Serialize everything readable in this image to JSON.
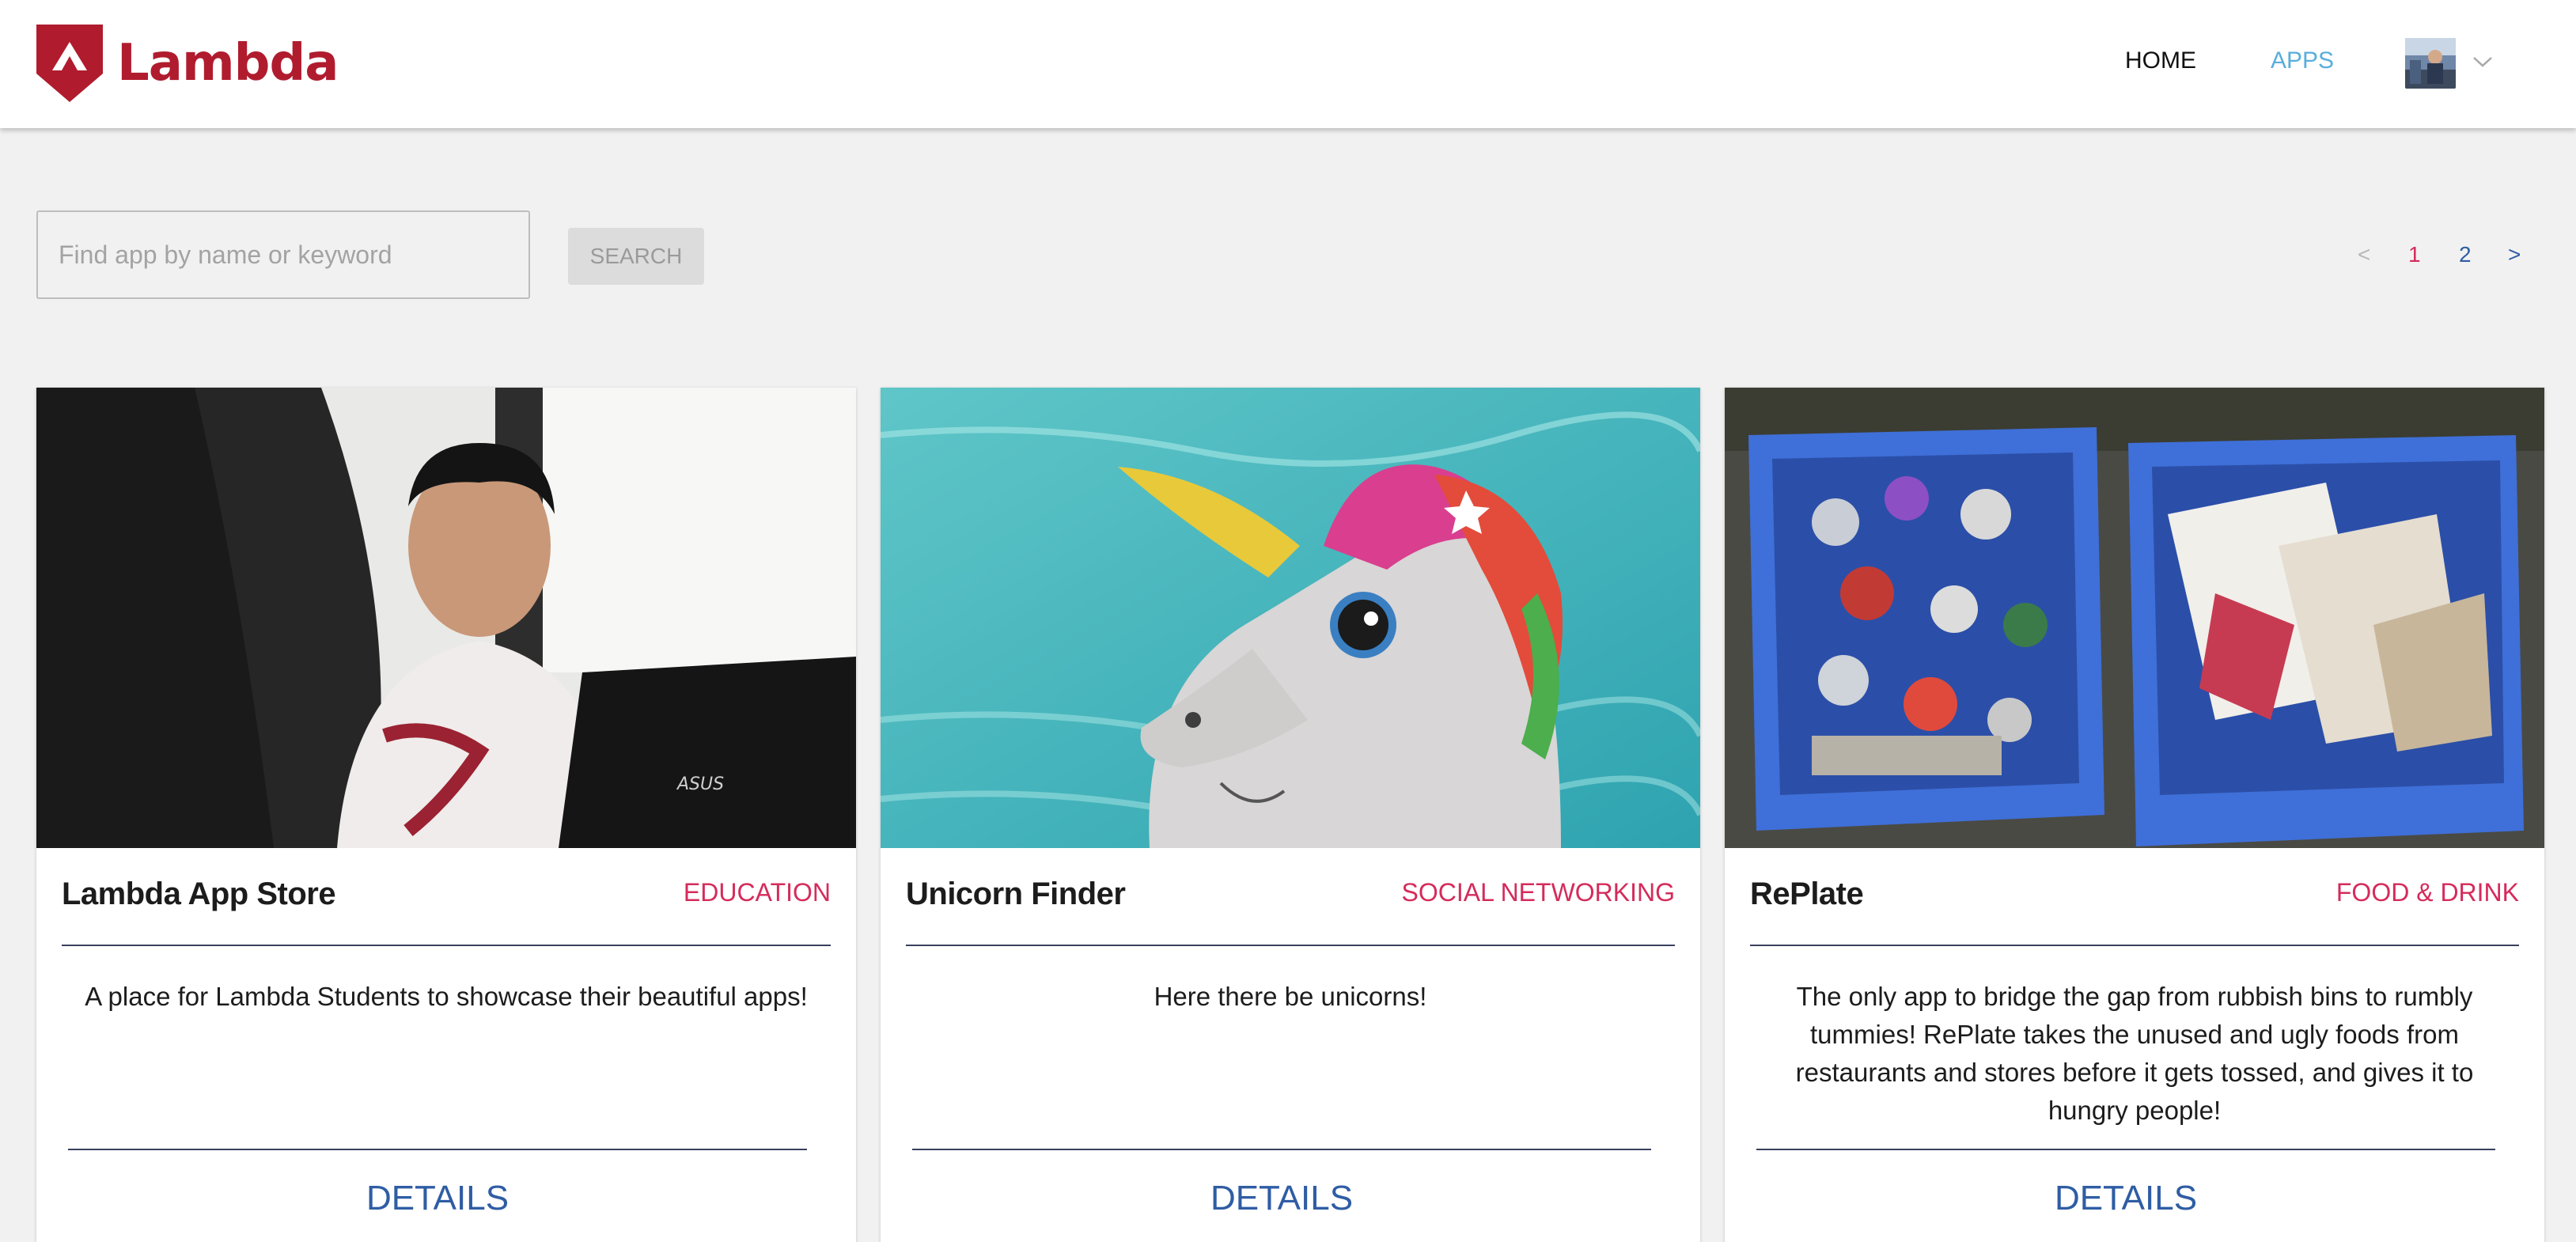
{
  "brand": {
    "name": "Lambda",
    "color": "#b01c2e"
  },
  "nav": {
    "home": "HOME",
    "apps": "APPS",
    "apps_color": "#5aaedc"
  },
  "user": {
    "avatar_icon": "user-avatar",
    "menu_icon": "chevron-down-icon"
  },
  "search": {
    "placeholder": "Find app by name or keyword",
    "value": "",
    "button": "SEARCH"
  },
  "pagination": {
    "prev": "<",
    "pages": [
      "1",
      "2"
    ],
    "current": "1",
    "next": ">"
  },
  "apps": [
    {
      "title": "Lambda App Store",
      "category": "EDUCATION",
      "description": "A place for Lambda Students to showcase their beautiful apps!",
      "details": "DETAILS",
      "image": "student-with-laptop-photo"
    },
    {
      "title": "Unicorn Finder",
      "category": "SOCIAL NETWORKING",
      "description": "Here there be unicorns!",
      "details": "DETAILS",
      "image": "inflatable-unicorn-pool-photo"
    },
    {
      "title": "RePlate",
      "category": "FOOD & DRINK",
      "description": "The only app to bridge the gap from rubbish bins to rumbly tummies! RePlate takes the unused and ugly foods from restaurants and stores before it gets tossed, and gives it to hungry people!",
      "details": "DETAILS",
      "image": "recycling-bins-photo"
    }
  ],
  "colors": {
    "category": "#d52b5b",
    "link": "#2f5da4",
    "background": "#f1f1f1"
  }
}
